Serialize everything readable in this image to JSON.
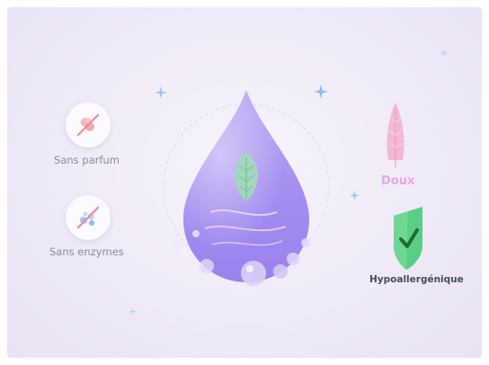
{
  "features": {
    "left": [
      {
        "label": "Sans parfum",
        "icon": "no-fragrance-icon"
      },
      {
        "label": "Sans enzymes",
        "icon": "no-enzymes-icon"
      }
    ],
    "right": [
      {
        "label": "Doux",
        "icon": "feather-icon"
      },
      {
        "label": "Hypoallergénique",
        "icon": "check-shield-icon"
      }
    ]
  },
  "center": {
    "icon": "water-drop-leaf-icon"
  },
  "colors": {
    "drop": "#a48df0",
    "leaf": "#9fd9b8",
    "feather": "#f3b8d6",
    "shield": "#58cf84",
    "doux_label": "#e6a6ea",
    "strike": "#f08a8a",
    "sparkle": "#9ec3f5"
  }
}
